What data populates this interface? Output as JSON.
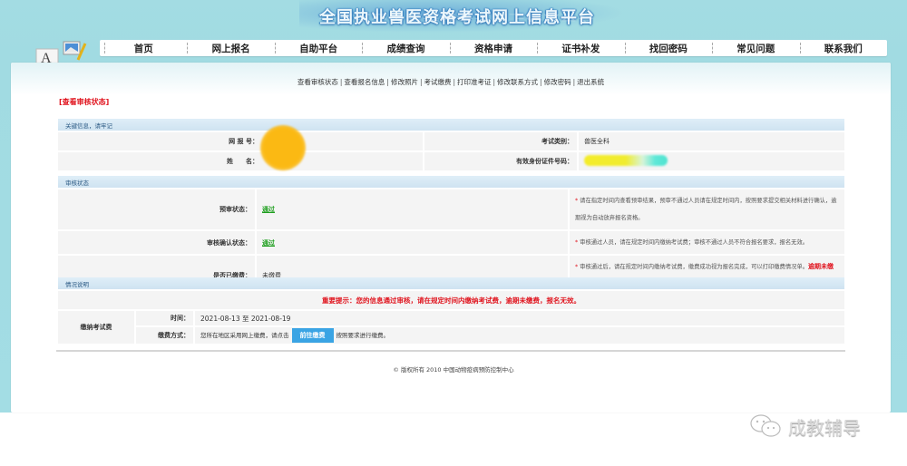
{
  "header": {
    "site_title": "全国执业兽医资格考试网上信息平台",
    "nav": [
      "首页",
      "网上报名",
      "自助平台",
      "成绩查询",
      "资格申请",
      "证书补发",
      "找回密码",
      "常见问题",
      "联系我们"
    ]
  },
  "sublinks": [
    "查看审核状态",
    "查看报名信息",
    "修改照片",
    "考试缴费",
    "打印准考证",
    "修改联系方式",
    "修改密码",
    "退出系统"
  ],
  "section_title": "[查看审核状态]",
  "key_info": {
    "header": "关键信息，请牢记",
    "reg_no_label": "网 报 号：",
    "name_label": "姓　　名：",
    "exam_type_label": "考试类别：",
    "exam_type_value": "兽医全科",
    "id_label": "有效身份证件号码："
  },
  "review": {
    "header": "审核状态",
    "rows": [
      {
        "label": "预审状态：",
        "value": "通过",
        "note": "请在指定时间内查看预审结果，预审不通过人员请在规定时间内，按照要求提交相关材料进行确认，逾期视为自动放弃报名资格。",
        "note_red": ""
      },
      {
        "label": "审核确认状态：",
        "value": "通过",
        "note": "审核通过人员，请在规定时间内缴纳考试费；审核不通过人员不符合报名要求，报名无效。",
        "note_red": ""
      },
      {
        "label": "是否已缴费：",
        "value": "未缴费",
        "note": "审核通过后，请在规定时间内缴纳考试费，缴费成功视为报名完成，可以打印缴费情况单。",
        "note_red": "逾期未缴费，报名无效。"
      }
    ]
  },
  "situation": {
    "header": "情况说明",
    "important": "重要提示：您的信息通过审核，请在规定时间内缴纳考试费，逾期未缴费，报名无效。",
    "fee_label": "缴纳考试费",
    "time_label": "时间：",
    "time_value": "2021-08-13 至 2021-08-19",
    "method_label": "缴费方式：",
    "method_prefix": "您所在地区采用网上缴费，请点击",
    "pay_button": "前往缴费",
    "method_suffix": "按照要求进行缴费。"
  },
  "footer": {
    "copyright": "© 版权所有 2010 中国动物疫病预防控制中心"
  },
  "watermark": {
    "text": "成教辅导"
  },
  "colors": {
    "accent_red": "#e0141e",
    "pass_green": "#1e9e1e",
    "button_blue": "#3aa4e4",
    "background_teal": "#a3dce3"
  }
}
